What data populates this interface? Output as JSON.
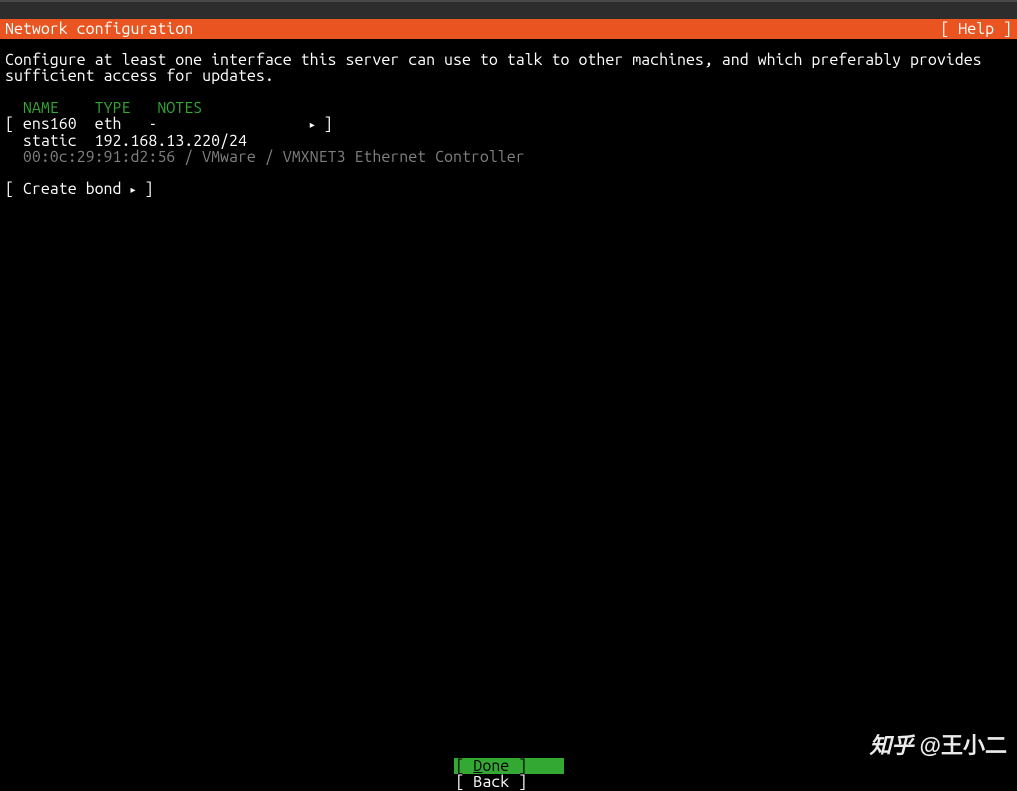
{
  "header": {
    "title": "Network configuration",
    "help_label": "[ Help ]"
  },
  "instruction": "Configure at least one interface this server can use to talk to other machines, and which preferably provides sufficient access for updates.",
  "interface_table": {
    "headers": {
      "name": "NAME",
      "type": "TYPE",
      "notes": "NOTES"
    },
    "rows": [
      {
        "name": "ens160",
        "type": "eth",
        "notes": "-",
        "mode": "static",
        "address": "192.168.13.220/24",
        "mac_detail": "00:0c:29:91:d2:56 / VMware / VMXNET3 Ethernet Controller"
      }
    ]
  },
  "create_bond_label": "Create bond",
  "triangle_icon": "▸",
  "buttons": {
    "done": "Done",
    "back": "Back"
  },
  "watermark": {
    "logo": "知乎",
    "text": "@王小二"
  }
}
